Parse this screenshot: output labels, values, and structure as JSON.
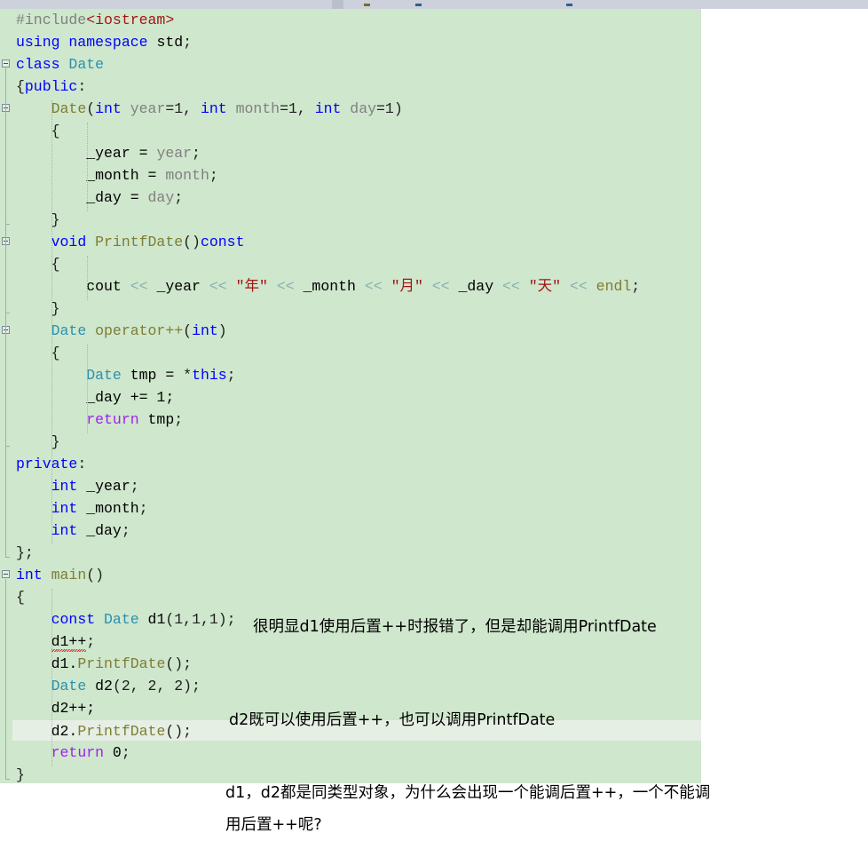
{
  "app": {
    "type": "code-editor",
    "language": "C++",
    "editor_background": "#cfe7cd",
    "current_line_background": "#e6efe4",
    "page_background": "#ffffff"
  },
  "toolbar": {
    "present": true,
    "background": "#ccd1dc",
    "markers": [
      "bookmark-mark",
      "breakpoint-mark",
      "breakpoint-mark"
    ]
  },
  "editor": {
    "current_line_index": 31,
    "error_marker": {
      "text": "d1++",
      "style": "red-squiggly-underline",
      "color": "#e03030"
    },
    "lines": [
      {
        "i": 0,
        "indent": 0,
        "fold": null,
        "tokens": [
          {
            "t": "#include",
            "c": "k-pre"
          },
          {
            "t": "<iostream>",
            "c": "k-str"
          }
        ]
      },
      {
        "i": 1,
        "indent": 0,
        "fold": null,
        "tokens": [
          {
            "t": "using namespace ",
            "c": "k-kw"
          },
          {
            "t": "std",
            "c": "k-id"
          },
          {
            "t": ";",
            "c": "k-punc"
          }
        ]
      },
      {
        "i": 2,
        "indent": 0,
        "fold": "open",
        "tokens": [
          {
            "t": "class ",
            "c": "k-kw"
          },
          {
            "t": "Date",
            "c": "k-type"
          }
        ]
      },
      {
        "i": 3,
        "indent": 0,
        "fold": null,
        "tokens": [
          {
            "t": "{",
            "c": "k-punc"
          },
          {
            "t": "public",
            "c": "k-kw"
          },
          {
            "t": ":",
            "c": "k-punc"
          }
        ]
      },
      {
        "i": 4,
        "indent": 1,
        "fold": "open",
        "tokens": [
          {
            "t": "Date",
            "c": "k-fn"
          },
          {
            "t": "(",
            "c": "k-punc"
          },
          {
            "t": "int ",
            "c": "k-kw"
          },
          {
            "t": "year",
            "c": "k-var"
          },
          {
            "t": "=1, ",
            "c": "k-punc"
          },
          {
            "t": "int ",
            "c": "k-kw"
          },
          {
            "t": "month",
            "c": "k-var"
          },
          {
            "t": "=1, ",
            "c": "k-punc"
          },
          {
            "t": "int ",
            "c": "k-kw"
          },
          {
            "t": "day",
            "c": "k-var"
          },
          {
            "t": "=1)",
            "c": "k-punc"
          }
        ]
      },
      {
        "i": 5,
        "indent": 1,
        "fold": null,
        "tokens": [
          {
            "t": "{",
            "c": "k-punc"
          }
        ]
      },
      {
        "i": 6,
        "indent": 2,
        "fold": null,
        "tokens": [
          {
            "t": "_year = ",
            "c": "k-id"
          },
          {
            "t": "year",
            "c": "k-var"
          },
          {
            "t": ";",
            "c": "k-punc"
          }
        ]
      },
      {
        "i": 7,
        "indent": 2,
        "fold": null,
        "tokens": [
          {
            "t": "_month = ",
            "c": "k-id"
          },
          {
            "t": "month",
            "c": "k-var"
          },
          {
            "t": ";",
            "c": "k-punc"
          }
        ]
      },
      {
        "i": 8,
        "indent": 2,
        "fold": null,
        "tokens": [
          {
            "t": "_day = ",
            "c": "k-id"
          },
          {
            "t": "day",
            "c": "k-var"
          },
          {
            "t": ";",
            "c": "k-punc"
          }
        ]
      },
      {
        "i": 9,
        "indent": 1,
        "fold": null,
        "tokens": [
          {
            "t": "}",
            "c": "k-punc"
          }
        ]
      },
      {
        "i": 10,
        "indent": 1,
        "fold": "open",
        "tokens": [
          {
            "t": "void ",
            "c": "k-kw"
          },
          {
            "t": "PrintfDate",
            "c": "k-fn"
          },
          {
            "t": "()",
            "c": "k-punc"
          },
          {
            "t": "const",
            "c": "k-kw"
          }
        ]
      },
      {
        "i": 11,
        "indent": 1,
        "fold": null,
        "tokens": [
          {
            "t": "{",
            "c": "k-punc"
          }
        ]
      },
      {
        "i": 12,
        "indent": 2,
        "fold": null,
        "tokens": [
          {
            "t": "cout ",
            "c": "k-id"
          },
          {
            "t": "<< ",
            "c": "k-op"
          },
          {
            "t": "_year ",
            "c": "k-id"
          },
          {
            "t": "<< ",
            "c": "k-op"
          },
          {
            "t": "\"年\"",
            "c": "k-str"
          },
          {
            "t": " ",
            "c": "k-punc"
          },
          {
            "t": "<< ",
            "c": "k-op"
          },
          {
            "t": "_month ",
            "c": "k-id"
          },
          {
            "t": "<< ",
            "c": "k-op"
          },
          {
            "t": "\"月\"",
            "c": "k-str"
          },
          {
            "t": " ",
            "c": "k-punc"
          },
          {
            "t": "<< ",
            "c": "k-op"
          },
          {
            "t": "_day ",
            "c": "k-id"
          },
          {
            "t": "<< ",
            "c": "k-op"
          },
          {
            "t": "\"天\"",
            "c": "k-str"
          },
          {
            "t": " ",
            "c": "k-punc"
          },
          {
            "t": "<< ",
            "c": "k-op"
          },
          {
            "t": "endl",
            "c": "k-fn"
          },
          {
            "t": ";",
            "c": "k-punc"
          }
        ]
      },
      {
        "i": 13,
        "indent": 1,
        "fold": null,
        "tokens": [
          {
            "t": "}",
            "c": "k-punc"
          }
        ]
      },
      {
        "i": 14,
        "indent": 1,
        "fold": "open",
        "tokens": [
          {
            "t": "Date ",
            "c": "k-type"
          },
          {
            "t": "operator++",
            "c": "k-fn"
          },
          {
            "t": "(",
            "c": "k-punc"
          },
          {
            "t": "int",
            "c": "k-kw"
          },
          {
            "t": ")",
            "c": "k-punc"
          }
        ]
      },
      {
        "i": 15,
        "indent": 1,
        "fold": null,
        "tokens": [
          {
            "t": "{",
            "c": "k-punc"
          }
        ]
      },
      {
        "i": 16,
        "indent": 2,
        "fold": null,
        "tokens": [
          {
            "t": "Date ",
            "c": "k-type"
          },
          {
            "t": "tmp = ",
            "c": "k-id"
          },
          {
            "t": "*",
            "c": "k-punc"
          },
          {
            "t": "this",
            "c": "k-kw"
          },
          {
            "t": ";",
            "c": "k-punc"
          }
        ]
      },
      {
        "i": 17,
        "indent": 2,
        "fold": null,
        "tokens": [
          {
            "t": "_day += 1;",
            "c": "k-id"
          }
        ]
      },
      {
        "i": 18,
        "indent": 2,
        "fold": null,
        "tokens": [
          {
            "t": "return ",
            "c": "k-ret"
          },
          {
            "t": "tmp",
            "c": "k-id"
          },
          {
            "t": ";",
            "c": "k-punc"
          }
        ]
      },
      {
        "i": 19,
        "indent": 1,
        "fold": null,
        "tokens": [
          {
            "t": "}",
            "c": "k-punc"
          }
        ]
      },
      {
        "i": 20,
        "indent": 0,
        "fold": null,
        "tokens": [
          {
            "t": "private",
            "c": "k-kw"
          },
          {
            "t": ":",
            "c": "k-punc"
          }
        ]
      },
      {
        "i": 21,
        "indent": 1,
        "fold": null,
        "tokens": [
          {
            "t": "int ",
            "c": "k-kw"
          },
          {
            "t": "_year",
            "c": "k-id"
          },
          {
            "t": ";",
            "c": "k-punc"
          }
        ]
      },
      {
        "i": 22,
        "indent": 1,
        "fold": null,
        "tokens": [
          {
            "t": "int ",
            "c": "k-kw"
          },
          {
            "t": "_month",
            "c": "k-id"
          },
          {
            "t": ";",
            "c": "k-punc"
          }
        ]
      },
      {
        "i": 23,
        "indent": 1,
        "fold": null,
        "tokens": [
          {
            "t": "int ",
            "c": "k-kw"
          },
          {
            "t": "_day",
            "c": "k-id"
          },
          {
            "t": ";",
            "c": "k-punc"
          }
        ]
      },
      {
        "i": 24,
        "indent": 0,
        "fold": null,
        "tokens": [
          {
            "t": "};",
            "c": "k-punc"
          }
        ]
      },
      {
        "i": 25,
        "indent": 0,
        "fold": "open",
        "tokens": [
          {
            "t": "int ",
            "c": "k-kw"
          },
          {
            "t": "main",
            "c": "k-fn"
          },
          {
            "t": "()",
            "c": "k-punc"
          }
        ]
      },
      {
        "i": 26,
        "indent": 0,
        "fold": null,
        "tokens": [
          {
            "t": "{",
            "c": "k-punc"
          }
        ]
      },
      {
        "i": 27,
        "indent": 1,
        "fold": null,
        "tokens": [
          {
            "t": "const ",
            "c": "k-kw"
          },
          {
            "t": "Date ",
            "c": "k-type"
          },
          {
            "t": "d1",
            "c": "k-id"
          },
          {
            "t": "(1,1,1);",
            "c": "k-punc"
          }
        ]
      },
      {
        "i": 28,
        "indent": 1,
        "fold": null,
        "error": true,
        "tokens": [
          {
            "t": "d1++",
            "c": "k-id",
            "err": true
          },
          {
            "t": ";",
            "c": "k-punc"
          }
        ]
      },
      {
        "i": 29,
        "indent": 1,
        "fold": null,
        "tokens": [
          {
            "t": "d1.",
            "c": "k-id"
          },
          {
            "t": "PrintfDate",
            "c": "k-fn"
          },
          {
            "t": "();",
            "c": "k-punc"
          }
        ]
      },
      {
        "i": 30,
        "indent": 1,
        "fold": null,
        "tokens": [
          {
            "t": "Date ",
            "c": "k-type"
          },
          {
            "t": "d2",
            "c": "k-id"
          },
          {
            "t": "(2, 2, 2);",
            "c": "k-punc"
          }
        ]
      },
      {
        "i": 31,
        "indent": 1,
        "fold": null,
        "tokens": [
          {
            "t": "d2++;",
            "c": "k-id"
          }
        ]
      },
      {
        "i": 32,
        "indent": 1,
        "fold": null,
        "current": true,
        "tokens": [
          {
            "t": "d2.",
            "c": "k-id"
          },
          {
            "t": "PrintfDate",
            "c": "k-fn"
          },
          {
            "t": "();",
            "c": "k-punc"
          }
        ]
      },
      {
        "i": 33,
        "indent": 1,
        "fold": null,
        "tokens": [
          {
            "t": "return ",
            "c": "k-ret"
          },
          {
            "t": "0",
            "c": "k-num"
          },
          {
            "t": ";",
            "c": "k-punc"
          }
        ]
      },
      {
        "i": 34,
        "indent": 0,
        "fold": null,
        "tokens": [
          {
            "t": "}",
            "c": "k-punc"
          }
        ]
      }
    ]
  },
  "annotations": {
    "note_1": "很明显d1使用后置++时报错了，但是却能调用PrintfDate",
    "note_2": "d2既可以使用后置++，也可以调用PrintfDate",
    "note_3_line1": "d1，d2都是同类型对象，为什么会出现一个能调后置++，一个不能调",
    "note_3_line2": "用后置++呢?"
  }
}
